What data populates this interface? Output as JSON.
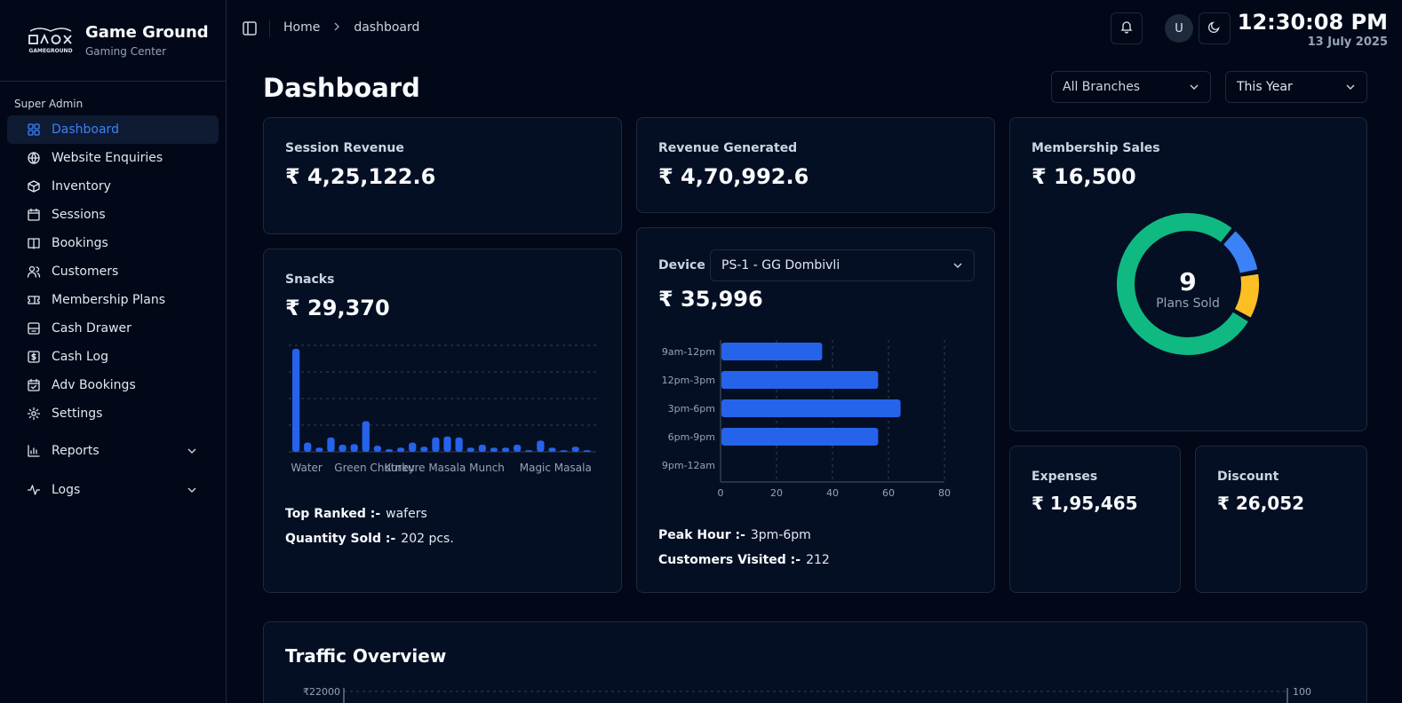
{
  "brand": {
    "name": "Game Ground",
    "subtitle": "Gaming Center",
    "logo_text": "GAMEGROUND"
  },
  "sidebar": {
    "section_label": "Super Admin",
    "items": [
      {
        "label": "Dashboard",
        "icon": "dashboard-icon"
      },
      {
        "label": "Website Enquiries",
        "icon": "globe-icon"
      },
      {
        "label": "Inventory",
        "icon": "box-icon"
      },
      {
        "label": "Sessions",
        "icon": "calendar-icon"
      },
      {
        "label": "Bookings",
        "icon": "book-icon"
      },
      {
        "label": "Customers",
        "icon": "users-icon"
      },
      {
        "label": "Membership Plans",
        "icon": "ticket-icon"
      },
      {
        "label": "Cash Drawer",
        "icon": "drawer-icon"
      },
      {
        "label": "Cash Log",
        "icon": "dollar-icon"
      },
      {
        "label": "Adv Bookings",
        "icon": "calendar-check-icon"
      },
      {
        "label": "Settings",
        "icon": "gear-icon"
      }
    ],
    "groups": [
      {
        "label": "Reports",
        "icon": "bar-chart-icon"
      },
      {
        "label": "Logs",
        "icon": "activity-icon"
      }
    ]
  },
  "topbar": {
    "breadcrumb": [
      "Home",
      "dashboard"
    ],
    "avatar_initial": "U",
    "time": "12:30:08 PM",
    "date": "13 July 2025"
  },
  "page": {
    "title": "Dashboard"
  },
  "filters": {
    "branch": "All Branches",
    "period": "This Year"
  },
  "cards": {
    "session_revenue": {
      "label": "Session Revenue",
      "value": "₹ 4,25,122.6"
    },
    "revenue_generated": {
      "label": "Revenue Generated",
      "value": "₹ 4,70,992.6"
    },
    "membership_sales": {
      "label": "Membership Sales",
      "value": "₹ 16,500",
      "center_value": "9",
      "center_label": "Plans Sold"
    },
    "snacks": {
      "label": "Snacks",
      "value": "₹ 29,370",
      "top_ranked_label": "Top Ranked :-",
      "top_ranked_value": "wafers",
      "qty_label": "Quantity Sold :-",
      "qty_value": "202 pcs."
    },
    "device": {
      "label": "Device",
      "selected": "PS-1 - GG Dombivli",
      "value": "₹ 35,996",
      "peak_label": "Peak Hour :-",
      "peak_value": "3pm-6pm",
      "visited_label": "Customers Visited :-",
      "visited_value": "212"
    },
    "expenses": {
      "label": "Expenses",
      "value": "₹ 1,95,465"
    },
    "discount": {
      "label": "Discount",
      "value": "₹ 26,052"
    },
    "traffic": {
      "title": "Traffic Overview",
      "left_tick": "₹22000",
      "right_tick": "100"
    }
  },
  "chart_data": [
    {
      "type": "bar",
      "name": "snacks",
      "tick_labels": [
        "Water",
        "Green Chutney",
        "Kurkure Masala Munch",
        "Magic Masala"
      ],
      "values": [
        202,
        18,
        8,
        28,
        14,
        15,
        60,
        12,
        5,
        8,
        18,
        10,
        28,
        30,
        28,
        8,
        14,
        8,
        8,
        14,
        3,
        22,
        8,
        3,
        10,
        3
      ],
      "color": "#2563eb",
      "grid": true
    },
    {
      "type": "bar",
      "orientation": "horizontal",
      "name": "device_hours",
      "categories": [
        "9am-12pm",
        "12pm-3pm",
        "3pm-6pm",
        "6pm-9pm",
        "9pm-12am"
      ],
      "values": [
        36,
        56,
        64,
        56,
        0
      ],
      "xticks": [
        0,
        20,
        40,
        60,
        80
      ],
      "xlim": [
        0,
        80
      ],
      "color": "#2563eb",
      "grid": true
    },
    {
      "type": "pie",
      "name": "membership_plans",
      "donut": true,
      "values": [
        7,
        1,
        1
      ],
      "colors": [
        "#10b981",
        "#3b82f6",
        "#fbbf24"
      ]
    }
  ],
  "colors": {
    "accent": "#3b82f6",
    "background": "#020817",
    "card": "#050f24",
    "border": "#1e293b"
  }
}
